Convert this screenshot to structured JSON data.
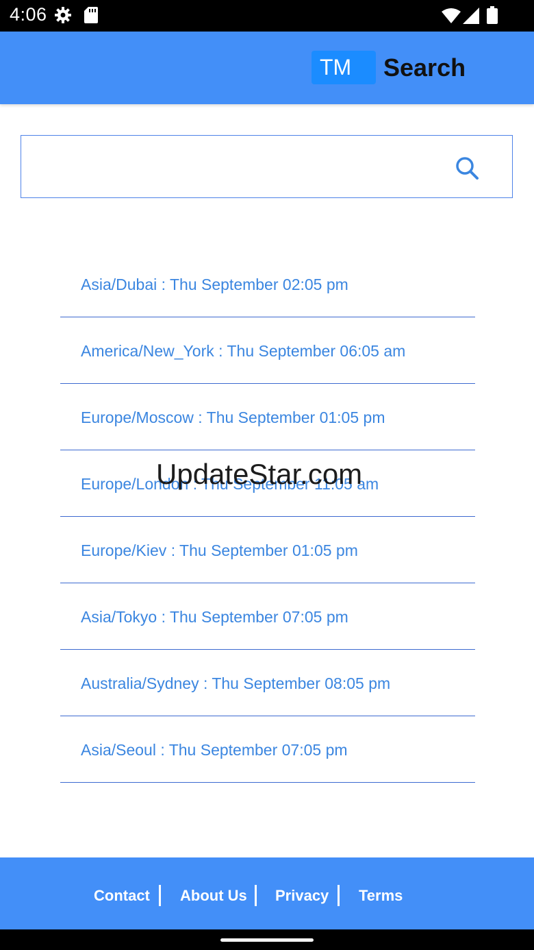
{
  "status_bar": {
    "time": "4:06",
    "icons": [
      "gear-icon",
      "sd-card-icon",
      "wifi-icon",
      "signal-icon",
      "battery-icon"
    ]
  },
  "header": {
    "logo_badge": "TM",
    "logo_text": "Search",
    "background_color": "#438ff8",
    "badge_color": "#1b8cff"
  },
  "search": {
    "value": "",
    "placeholder": "",
    "icon": "search-icon"
  },
  "timezones": [
    {
      "label": "Asia/Dubai : Thu September 02:05 pm"
    },
    {
      "label": "America/New_York : Thu September 06:05 am"
    },
    {
      "label": "Europe/Moscow : Thu September 01:05 pm"
    },
    {
      "label": "Europe/London : Thu September 11:05 am"
    },
    {
      "label": "Europe/Kiev : Thu September 01:05 pm"
    },
    {
      "label": "Asia/Tokyo : Thu September 07:05 pm"
    },
    {
      "label": "Australia/Sydney : Thu September 08:05 pm"
    },
    {
      "label": "Asia/Seoul : Thu September 07:05 pm"
    }
  ],
  "watermark": "UpdateStar.com",
  "footer": {
    "links": [
      "Contact",
      "About Us",
      "Privacy",
      "Terms"
    ]
  }
}
